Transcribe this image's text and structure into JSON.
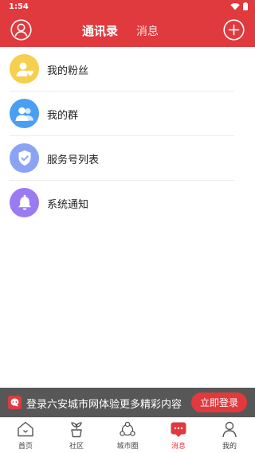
{
  "status_bar": {
    "time": "1:54"
  },
  "header": {
    "tabs": [
      {
        "label": "通讯录",
        "active": true
      },
      {
        "label": "消息",
        "active": false
      }
    ]
  },
  "list": [
    {
      "label": "我的粉丝",
      "icon": "fans-icon",
      "color": "#f5cf4e"
    },
    {
      "label": "我的群",
      "icon": "group-icon",
      "color": "#4a9ff2"
    },
    {
      "label": "服务号列表",
      "icon": "shield-check-icon",
      "color": "#8aa3f5"
    },
    {
      "label": "系统通知",
      "icon": "bell-icon",
      "color": "#9b7bf0"
    }
  ],
  "login_banner": {
    "text": "登录六安城市网体验更多精彩内容",
    "button": "立即登录"
  },
  "bottom_nav": [
    {
      "label": "首页",
      "icon": "home-icon",
      "active": false
    },
    {
      "label": "社区",
      "icon": "community-icon",
      "active": false
    },
    {
      "label": "城市圈",
      "icon": "city-circle-icon",
      "active": false
    },
    {
      "label": "消息",
      "icon": "message-icon",
      "active": true
    },
    {
      "label": "我的",
      "icon": "profile-icon",
      "active": false
    }
  ],
  "colors": {
    "brand": "#e03a3e",
    "banner_bg": "#575757"
  }
}
